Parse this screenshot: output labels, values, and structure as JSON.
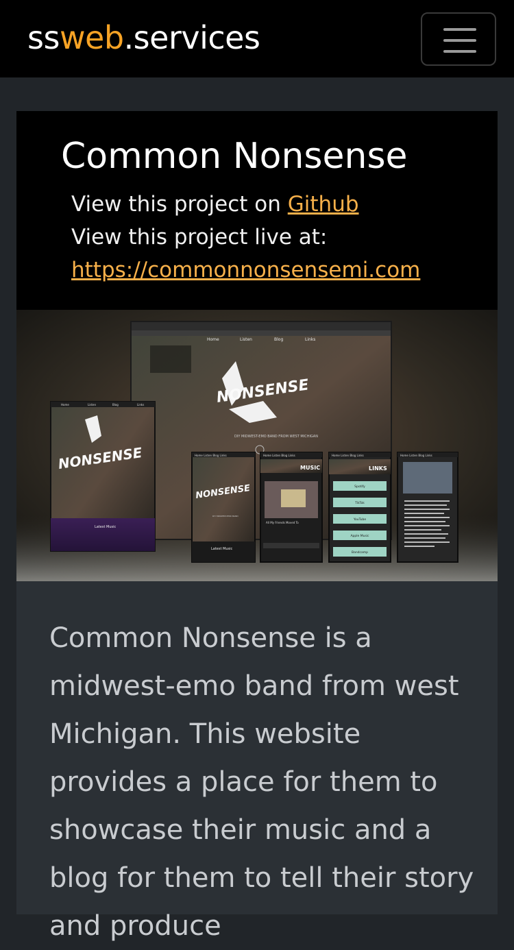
{
  "navbar": {
    "brand_prefix": "ss",
    "brand_accent": "web",
    "brand_suffix": ".services",
    "menu_icon": "hamburger-icon"
  },
  "project": {
    "title": "Common Nonsense",
    "github_prefix": "View this project on ",
    "github_link": "Github",
    "live_prefix": "View this project live at:",
    "live_url": "https://commonnonsensemi.com",
    "description": "Common Nonsense is a midwest-emo band from west Michigan. This website provides a place for them to showcase their music and a blog for them to tell their story and produce"
  },
  "screenshot": {
    "nav": [
      "Home",
      "Listen",
      "Blog",
      "Links"
    ],
    "tagline": "DIY MIDWEST-EMO BAND FROM WEST MICHIGAN",
    "latest_music": "Latest Music",
    "music_heading": "MUSIC",
    "links_heading": "LINKS",
    "link_buttons": [
      "Spotify",
      "TikTok",
      "YouTube",
      "Apple Music",
      "Bandcamp"
    ],
    "track": "All My Friends Moved To Other States"
  },
  "colors": {
    "accent": "#f7a325",
    "link": "#f7b04a",
    "background": "#212529",
    "header_bg": "#000000",
    "link_button_bg": "#9fd4c4"
  }
}
